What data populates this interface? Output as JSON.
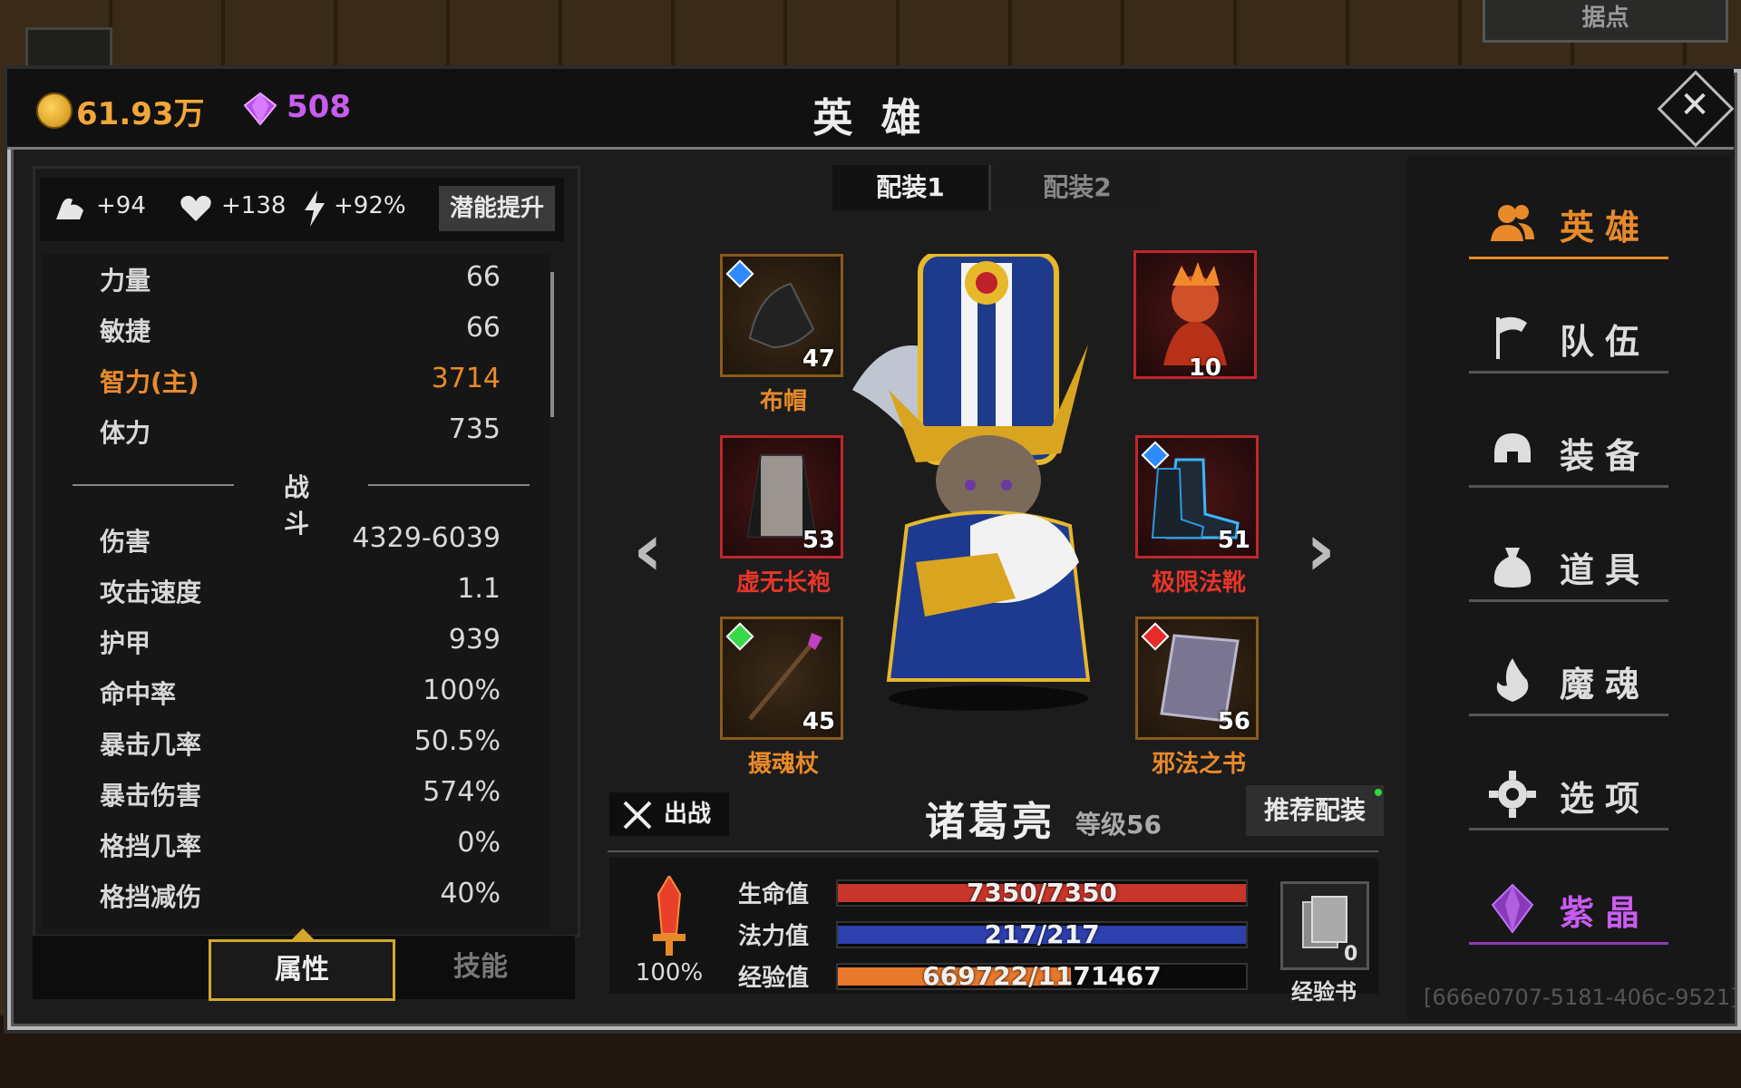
{
  "background": {
    "top_tab": "据点"
  },
  "header": {
    "gold": "61.93万",
    "gems": "508",
    "title": "英 雄",
    "close_icon": "close-icon"
  },
  "potential": {
    "str": "+94",
    "hp": "+138",
    "energy": "+92%",
    "button": "潜能提升"
  },
  "stats": [
    {
      "label": "力量",
      "value": "66"
    },
    {
      "label": "敏捷",
      "value": "66"
    },
    {
      "label": "智力(主)",
      "value": "3714"
    },
    {
      "label": "体力",
      "value": "735"
    }
  ],
  "combat_title": "战 斗",
  "combat": [
    {
      "label": "伤害",
      "value": "4329-6039"
    },
    {
      "label": "攻击速度",
      "value": "1.1"
    },
    {
      "label": "护甲",
      "value": "939"
    },
    {
      "label": "命中率",
      "value": "100%"
    },
    {
      "label": "暴击几率",
      "value": "50.5%"
    },
    {
      "label": "暴击伤害",
      "value": "574%"
    },
    {
      "label": "格挡几率",
      "value": "0%"
    },
    {
      "label": "格挡减伤",
      "value": "40%"
    }
  ],
  "left_tabs": {
    "attr": "属性",
    "skill": "技能"
  },
  "loadout": {
    "tab1": "配装1",
    "tab2": "配装2"
  },
  "equipment": [
    {
      "name": "布帽",
      "level": "47",
      "gem_color": "#2e8bff",
      "name_color": "#e88a2a"
    },
    {
      "name": "虚无长袍",
      "level": "53",
      "gem_color": "",
      "name_color": "#e8352a"
    },
    {
      "name": "摄魂杖",
      "level": "45",
      "gem_color": "#38d84a",
      "name_color": "#e88a2a"
    },
    {
      "name": "",
      "level": "10",
      "gem_color": "",
      "name_color": "#e8352a"
    },
    {
      "name": "极限法靴",
      "level": "51",
      "gem_color": "#2e8bff",
      "name_color": "#e8352a"
    },
    {
      "name": "邪法之书",
      "level": "56",
      "gem_color": "#e82a2a",
      "name_color": "#e88a2a"
    }
  ],
  "hero": {
    "name": "诸葛亮",
    "level": "等级56",
    "deploy": "出战",
    "recommend": "推荐配装"
  },
  "bars": {
    "hp": {
      "label": "生命值",
      "text": "7350/7350",
      "fraction": 1.0,
      "color": "#c8352a"
    },
    "mp": {
      "label": "法力值",
      "text": "217/217",
      "fraction": 1.0,
      "color": "#2e3fae"
    },
    "exp": {
      "label": "经验值",
      "text": "669722/1171467",
      "fraction": 0.5717,
      "color": "#e8782a"
    }
  },
  "power_pct": "100%",
  "expbook": {
    "count": "0",
    "label": "经验书"
  },
  "nav": [
    {
      "label": "英雄",
      "icon": "heroes-icon",
      "active": true
    },
    {
      "label": "队伍",
      "icon": "flag-icon",
      "active": false
    },
    {
      "label": "装备",
      "icon": "helmet-icon",
      "active": false
    },
    {
      "label": "道具",
      "icon": "bag-icon",
      "active": false
    },
    {
      "label": "魔魂",
      "icon": "flame-icon",
      "active": false
    },
    {
      "label": "选项",
      "icon": "gear-icon",
      "active": false
    },
    {
      "label": "紫晶",
      "icon": "crystal-icon",
      "active": false
    }
  ],
  "uuid": "[666e0707-5181-406c-9521]"
}
